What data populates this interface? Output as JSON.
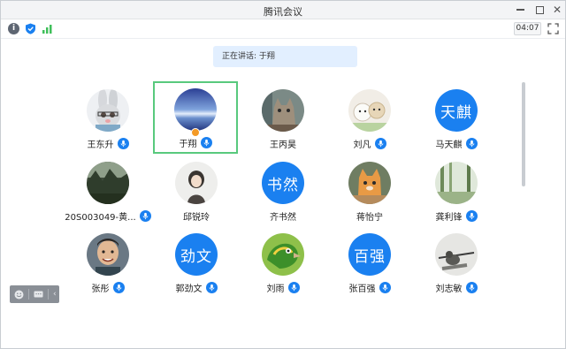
{
  "window": {
    "title": "腾讯会议"
  },
  "toolbar": {
    "timer": "04:07"
  },
  "banner": {
    "label": "正在讲话:",
    "speaker": "于翔"
  },
  "participants": [
    {
      "name": "王东升",
      "avatar": "rabbit-cartoon",
      "mic": true
    },
    {
      "name": "于翔",
      "avatar": "blue-horizon",
      "mic": true,
      "active": true,
      "host": true
    },
    {
      "name": "王丙昊",
      "avatar": "cat-photo",
      "mic": false
    },
    {
      "name": "刘凡",
      "avatar": "cartoon-animals",
      "mic": true
    },
    {
      "name": "马天麒",
      "avatar_text": "天麒",
      "mic": true
    },
    {
      "name": "20S003049-黄...",
      "avatar": "forest-landscape",
      "mic": true
    },
    {
      "name": "邱锐玲",
      "avatar": "girl-illustration",
      "mic": false
    },
    {
      "name": "齐书然",
      "avatar_text": "书然",
      "mic": false
    },
    {
      "name": "蒋怡宁",
      "avatar": "orange-cat",
      "mic": false
    },
    {
      "name": "龚利锋",
      "avatar": "bamboo-scene",
      "mic": true
    },
    {
      "name": "张彤",
      "avatar": "smiling-boy",
      "mic": true
    },
    {
      "name": "郭劲文",
      "avatar_text": "劲文",
      "mic": true
    },
    {
      "name": "刘雨",
      "avatar": "parrot",
      "mic": true
    },
    {
      "name": "张百强",
      "avatar_text": "百强",
      "mic": true
    },
    {
      "name": "刘志敏",
      "avatar": "soldier-sketch",
      "mic": true
    }
  ],
  "colors": {
    "accent": "#1a80f0",
    "active_border": "#58c97d",
    "banner_bg": "#e2efff"
  }
}
